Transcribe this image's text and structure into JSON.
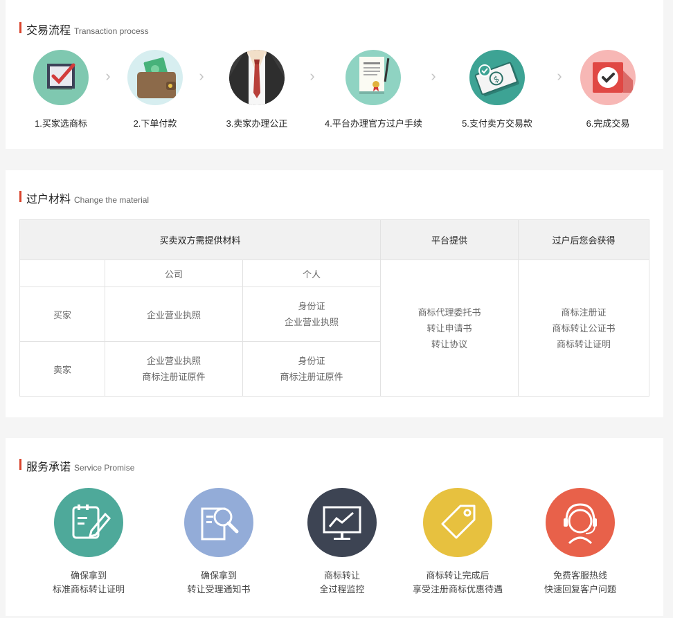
{
  "process": {
    "title_cn": "交易流程",
    "title_en": "Transaction process",
    "steps": [
      {
        "label": "1.买家选商标",
        "icon": "checkbox-icon",
        "color": "#7fc8b0"
      },
      {
        "label": "2.下单付款",
        "icon": "wallet-icon",
        "color": "#d7eef0"
      },
      {
        "label": "3.卖家办理公正",
        "icon": "suit-icon",
        "color": "#3b3b3b"
      },
      {
        "label": "4.平台办理官方过户手续",
        "icon": "certificate-icon",
        "color": "#8fd3c2"
      },
      {
        "label": "5.支付卖方交易款",
        "icon": "money-icon",
        "color": "#3da394"
      },
      {
        "label": "6.完成交易",
        "icon": "done-check-icon",
        "color": "#f7b7b5"
      }
    ]
  },
  "materials": {
    "title_cn": "过户材料",
    "title_en": "Change the material",
    "headers": [
      "买卖双方需提供材料",
      "平台提供",
      "过户后您会获得"
    ],
    "sub_headers": [
      "公司",
      "个人"
    ],
    "rows": [
      {
        "party": "买家",
        "company": "企业营业执照",
        "personal_1": "身份证",
        "personal_2": "企业营业执照"
      },
      {
        "party": "卖家",
        "company_1": "企业营业执照",
        "company_2": "商标注册证原件",
        "personal_1": "身份证",
        "personal_2": "商标注册证原件"
      }
    ],
    "platform": [
      "商标代理委托书",
      "转让申请书",
      "转让协议"
    ],
    "obtain": [
      "商标注册证",
      "商标转让公证书",
      "商标转让证明"
    ]
  },
  "service": {
    "title_cn": "服务承诺",
    "title_en": "Service Promise",
    "items": [
      {
        "line1": "确保拿到",
        "line2": "标准商标转让证明",
        "icon": "notepad-pen-icon",
        "color": "#4ea99a"
      },
      {
        "line1": "确保拿到",
        "line2": "转让受理通知书",
        "icon": "document-search-icon",
        "color": "#93acd8"
      },
      {
        "line1": "商标转让",
        "line2": "全过程监控",
        "icon": "monitor-chart-icon",
        "color": "#3d4453"
      },
      {
        "line1": "商标转让完成后",
        "line2": "享受注册商标优惠待遇",
        "icon": "price-tag-icon",
        "color": "#e7c13f"
      },
      {
        "line1": "免费客服热线",
        "line2": "快速回复客户问题",
        "icon": "headset-agent-icon",
        "color": "#e8614a"
      }
    ]
  }
}
